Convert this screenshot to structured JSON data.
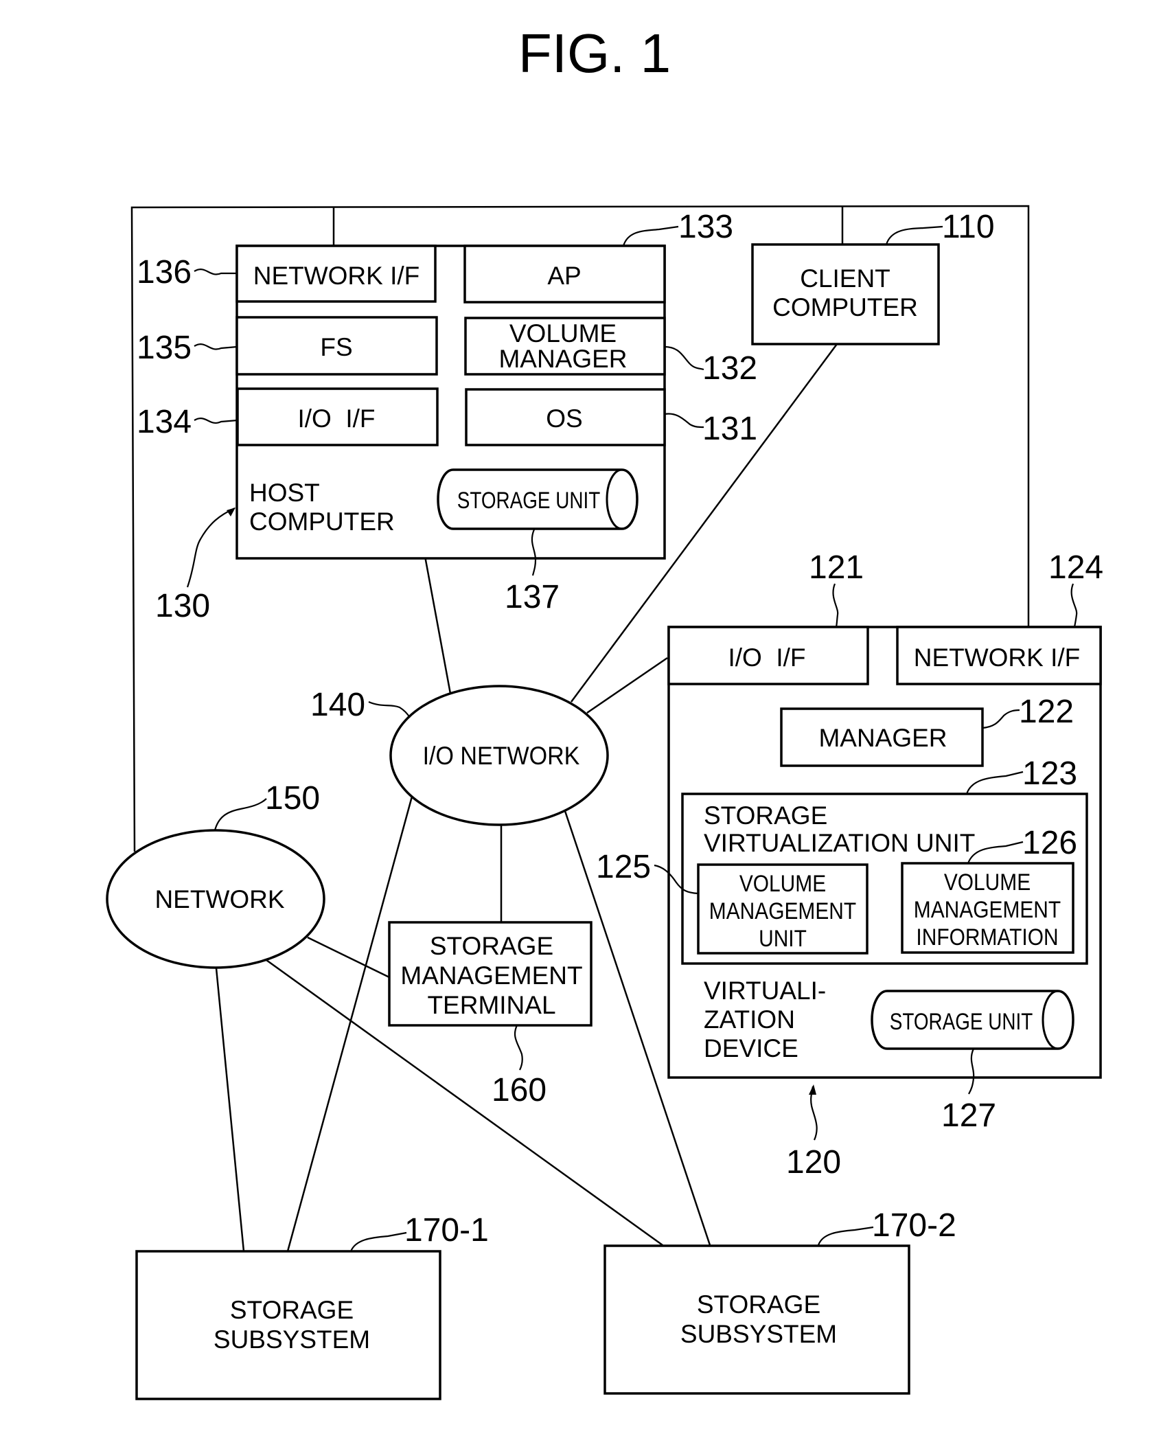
{
  "figure": {
    "title": "FIG. 1",
    "line_color": "#000000",
    "background": "#ffffff"
  },
  "host_computer": {
    "ref": "130",
    "label_lines": [
      "HOST",
      "COMPUTER"
    ],
    "network_if": {
      "ref": "136",
      "label": "NETWORK I/F"
    },
    "ap": {
      "ref": "133",
      "label": "AP"
    },
    "fs": {
      "ref": "135",
      "label": "FS"
    },
    "volume_manager": {
      "ref": "132",
      "label_lines": [
        "VOLUME",
        "MANAGER"
      ]
    },
    "io_if": {
      "ref": "134",
      "label": "I/O  I/F"
    },
    "os": {
      "ref": "131",
      "label": "OS"
    },
    "storage_unit": {
      "ref": "137",
      "label": "STORAGE UNIT"
    }
  },
  "client_computer": {
    "ref": "110",
    "label_lines": [
      "CLIENT",
      "COMPUTER"
    ]
  },
  "virtualization_device": {
    "ref": "120",
    "label_lines": [
      "VIRTUALI-",
      "ZATION",
      "DEVICE"
    ],
    "io_if": {
      "ref": "121",
      "label": "I/O  I/F"
    },
    "network_if": {
      "ref": "124",
      "label": "NETWORK I/F"
    },
    "manager": {
      "ref": "122",
      "label": "MANAGER"
    },
    "storage_virtualization_unit": {
      "ref": "123",
      "label_lines": [
        "STORAGE",
        "VIRTUALIZATION UNIT"
      ],
      "volume_management_unit": {
        "ref": "125",
        "label_lines": [
          "VOLUME",
          "MANAGEMENT",
          "UNIT"
        ]
      },
      "volume_management_information": {
        "ref": "126",
        "label_lines": [
          "VOLUME",
          "MANAGEMENT",
          "INFORMATION"
        ]
      }
    },
    "storage_unit": {
      "ref": "127",
      "label": "STORAGE UNIT"
    }
  },
  "io_network": {
    "ref": "140",
    "label": "I/O NETWORK"
  },
  "network": {
    "ref": "150",
    "label": "NETWORK"
  },
  "storage_management_terminal": {
    "ref": "160",
    "label_lines": [
      "STORAGE",
      "MANAGEMENT",
      "TERMINAL"
    ]
  },
  "storage_subsystems": [
    {
      "ref": "170-1",
      "label_lines": [
        "STORAGE",
        "SUBSYSTEM"
      ]
    },
    {
      "ref": "170-2",
      "label_lines": [
        "STORAGE",
        "SUBSYSTEM"
      ]
    }
  ]
}
